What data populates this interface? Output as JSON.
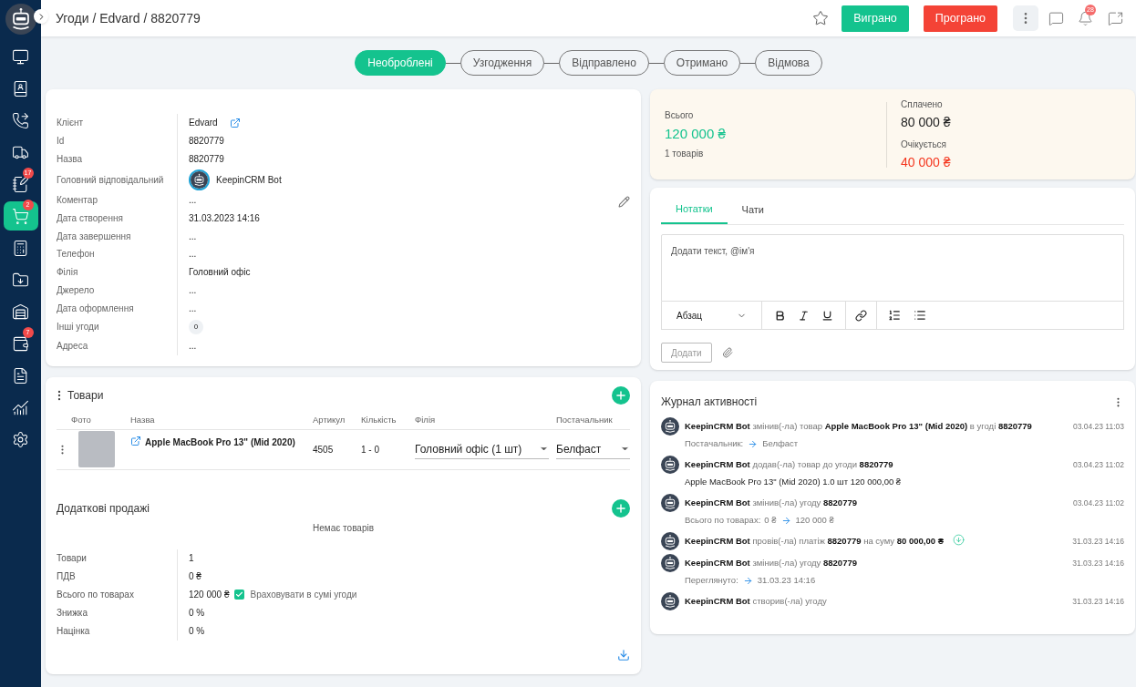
{
  "sidebar": {
    "items": [
      {
        "selected": false
      },
      {
        "selected": false
      },
      {
        "selected": false
      },
      {
        "selected": false
      },
      {
        "selected": false,
        "badge": "17"
      },
      {
        "selected": true,
        "badge": "2"
      },
      {
        "selected": false
      },
      {
        "selected": false
      },
      {
        "selected": false
      },
      {
        "selected": false,
        "badge": "7"
      },
      {
        "selected": false
      },
      {
        "selected": false
      },
      {
        "selected": false
      }
    ]
  },
  "header": {
    "breadcrumb": "Угоди / Edvard / 8820779",
    "won_button": "Виграно",
    "lost_button": "Програно",
    "notifications_badge": "28"
  },
  "pipeline": [
    {
      "label": "Необроблені",
      "selected": true
    },
    {
      "label": "Узгодження",
      "selected": false
    },
    {
      "label": "Відправлено",
      "selected": false
    },
    {
      "label": "Отримано",
      "selected": false
    },
    {
      "label": "Відмова",
      "selected": false
    }
  ],
  "details": [
    {
      "label": "Клієнт",
      "value": "Edvard",
      "kind": "link"
    },
    {
      "label": "Id",
      "value": "8820779",
      "kind": "text"
    },
    {
      "label": "Назва",
      "value": "8820779",
      "kind": "text"
    },
    {
      "label": "Головний відповідальний",
      "value": "KeepinCRM Bot",
      "kind": "user"
    },
    {
      "label": "Коментар",
      "value": "...",
      "kind": "text"
    },
    {
      "label": "Дата створення",
      "value": "31.03.2023 14:16",
      "kind": "text"
    },
    {
      "label": "Дата завершення",
      "value": "...",
      "kind": "text"
    },
    {
      "label": "Телефон",
      "value": "...",
      "kind": "text"
    },
    {
      "label": "Філія",
      "value": "Головний офіс",
      "kind": "text"
    },
    {
      "label": "Джерело",
      "value": "...",
      "kind": "text"
    },
    {
      "label": "Дата оформлення",
      "value": "...",
      "kind": "text"
    },
    {
      "label": "Інші угоди",
      "value": "0",
      "kind": "count"
    },
    {
      "label": "Адреса",
      "value": "...",
      "kind": "text"
    }
  ],
  "products": {
    "title": "Товари",
    "columns": [
      "Фото",
      "Назва",
      "Артикул",
      "Кількість",
      "Філія",
      "Постачальник"
    ],
    "rows": [
      {
        "name": "Apple MacBook Pro 13\" (Mid 2020)",
        "sku": "4505",
        "quantity": "1 - 0",
        "branch": "Головний офіс (1 шт)",
        "supplier": "Белфаст"
      }
    ]
  },
  "extra_sales": {
    "title": "Додаткові продажі",
    "empty": "Немає товарів",
    "summary": [
      {
        "label": "Товари",
        "value": "1"
      },
      {
        "label": "ПДВ",
        "value": "0 ₴"
      },
      {
        "label": "Всього по товарах",
        "value": "120 000 ₴",
        "checkbox": {
          "label": "Враховувати в сумі угоди",
          "checked": true
        }
      },
      {
        "label": "Знижка",
        "value": "0 %"
      },
      {
        "label": "Націнка",
        "value": "0 %"
      }
    ]
  },
  "totals": {
    "total_label": "Всього",
    "total": "120 000 ₴",
    "items_count": "1 товарів",
    "paid_label": "Сплачено",
    "paid": "80 000 ₴",
    "expected_label": "Очікується",
    "expected": "40 000 ₴"
  },
  "notes": {
    "tabs": [
      {
        "label": "Нотатки",
        "selected": true
      },
      {
        "label": "Чати",
        "selected": false
      }
    ],
    "placeholder": "Додати текст, @ім'я",
    "format": "Абзац",
    "submit": "Додати"
  },
  "activity": {
    "title": "Журнал активності",
    "entries": [
      {
        "text": "**KeepinCRM Bot** змінив(-ла) товар **Apple MacBook Pro 13\" (Mid 2020)** в угоді **8820779**",
        "time": "03.04.23 11:03",
        "payment": false,
        "detail": {
          "kind": "change",
          "label": "Постачальник:",
          "to": "Белфаст"
        }
      },
      {
        "text": "**KeepinCRM Bot** додав(-ла) товар до угоди **8820779**",
        "time": "03.04.23 11:02",
        "payment": false,
        "detail": {
          "kind": "text",
          "text": "Apple MacBook Pro 13\" (Mid 2020) 1.0 шт 120 000,00 ₴"
        }
      },
      {
        "text": "**KeepinCRM Bot** змінив(-ла) угоду **8820779**",
        "time": "03.04.23 11:02",
        "payment": false,
        "detail": {
          "kind": "change",
          "label": "Всього по товарах:",
          "from": "0 ₴",
          "to": "120 000 ₴"
        }
      },
      {
        "text": "**KeepinCRM Bot** провів(-ла) платіж **8820779** на суму **80 000,00 ₴**",
        "time": "31.03.23 14:16",
        "payment": true
      },
      {
        "text": "**KeepinCRM Bot** змінив(-ла) угоду **8820779**",
        "time": "31.03.23 14:16",
        "payment": false,
        "detail": {
          "kind": "change",
          "label": "Переглянуто:",
          "to": "31.03.23 14:16"
        }
      },
      {
        "text": "**KeepinCRM Bot** створив(-ла) угоду",
        "time": "31.03.23 14:16",
        "payment": false
      }
    ]
  }
}
